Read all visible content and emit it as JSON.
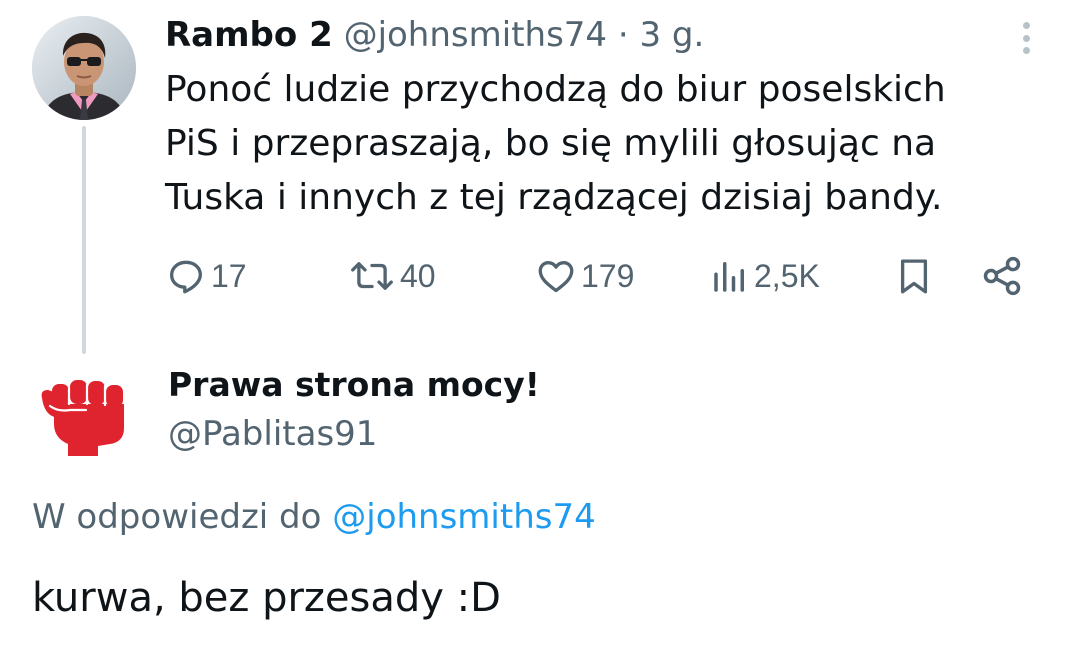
{
  "parent_tweet": {
    "author_name": "Rambo 2",
    "handle": "@johnsmiths74",
    "separator": "·",
    "time": "3 g.",
    "text_lines": [
      "Ponoć ludzie przychodzą do biur poselskich",
      "PiS i przepraszają, bo się mylili głosując na",
      "Tuska i innych z tej rządzącej dzisiaj bandy."
    ],
    "stats": {
      "replies": "17",
      "retweets": "40",
      "likes": "179",
      "views": "2,5K"
    },
    "icons": {
      "more": "more-vertical-icon",
      "reply": "reply-icon",
      "retweet": "retweet-icon",
      "like": "heart-icon",
      "views": "views-icon",
      "bookmark": "bookmark-icon",
      "share": "share-icon"
    }
  },
  "reply_tweet": {
    "author_name": "Prawa strona mocy!",
    "handle": "@Pablitas91",
    "reply_to_label": "W odpowiedzi do",
    "reply_to_handle": "@johnsmiths74",
    "text": "kurwa, bez przesady :D",
    "avatar_icon": "raised-fist-icon"
  },
  "colors": {
    "text_primary": "#0f1419",
    "text_secondary": "#536471",
    "link": "#1d9bf0",
    "thread_line": "#cfd9de",
    "fist": "#e0242f"
  }
}
